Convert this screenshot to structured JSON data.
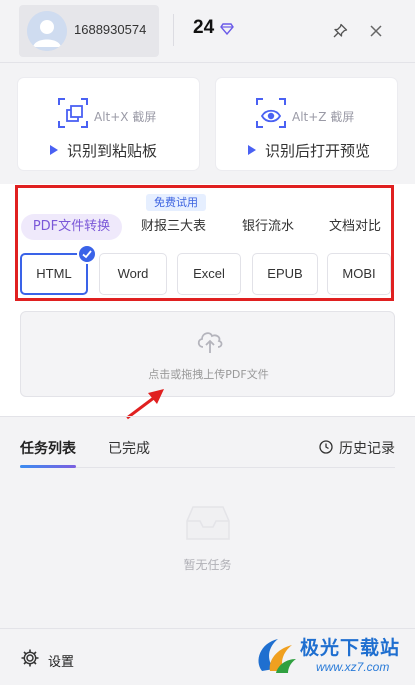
{
  "header": {
    "user_id": "1688930574",
    "points": "24",
    "icons": [
      "avatar",
      "diamond-icon",
      "pin-icon",
      "close-icon"
    ]
  },
  "capture": {
    "cards": [
      {
        "hotkey": "Alt+X 截屏",
        "action": "识别到粘贴板",
        "icon": "screenshot-copy-icon"
      },
      {
        "hotkey": "Alt+Z 截屏",
        "action": "识别后打开预览",
        "icon": "screenshot-preview-icon"
      }
    ]
  },
  "convert": {
    "free_badge": "免费试用",
    "tabs": [
      {
        "label": "PDF文件转换",
        "active": true
      },
      {
        "label": "财报三大表",
        "active": false
      },
      {
        "label": "银行流水",
        "active": false
      },
      {
        "label": "文档对比",
        "active": false
      }
    ],
    "formats": [
      {
        "label": "HTML",
        "selected": true
      },
      {
        "label": "Word",
        "selected": false
      },
      {
        "label": "Excel",
        "selected": false
      },
      {
        "label": "EPUB",
        "selected": false
      },
      {
        "label": "MOBI",
        "selected": false
      }
    ],
    "upload_text": "点击或拖拽上传PDF文件"
  },
  "tasks": {
    "tabs": [
      {
        "label": "任务列表",
        "active": true
      },
      {
        "label": "已完成",
        "active": false
      }
    ],
    "history_label": "历史记录",
    "empty_text": "暂无任务"
  },
  "footer": {
    "settings_label": "设置"
  },
  "watermark": {
    "title": "极光下载站",
    "url": "www.xz7.com"
  },
  "colors": {
    "accent": "#3a63e8",
    "active_tab_bg": "#efe9fb",
    "active_tab_text": "#7b58d8",
    "highlight_frame": "#e02020"
  }
}
